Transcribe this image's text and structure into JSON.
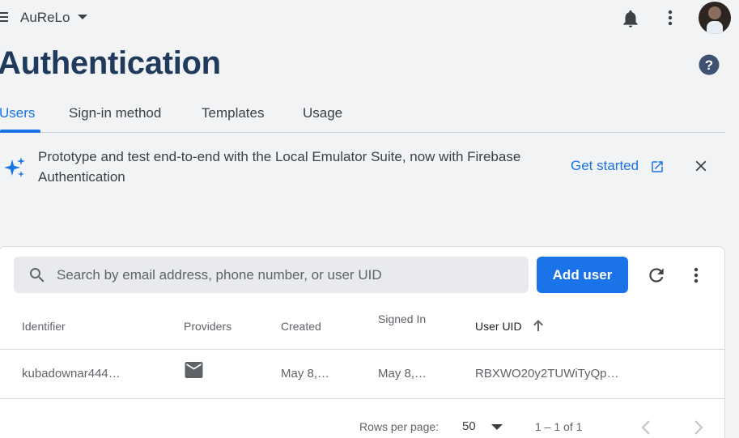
{
  "topbar": {
    "project_name": "AuReLo",
    "icons": [
      "menu-icon",
      "dropdown-caret-icon",
      "notifications-bell-icon",
      "more-vert-icon",
      "avatar"
    ]
  },
  "page": {
    "title": "Authentication",
    "help_icon": "help-icon"
  },
  "tabs": [
    {
      "label": "Users",
      "active": true
    },
    {
      "label": "Sign-in method",
      "active": false
    },
    {
      "label": "Templates",
      "active": false
    },
    {
      "label": "Usage",
      "active": false
    }
  ],
  "banner": {
    "text": "Prototype and test end-to-end with the Local Emulator Suite, now with Firebase Authentication",
    "action_label": "Get started",
    "icon": "sparkle-icon"
  },
  "toolbar": {
    "search_placeholder": "Search by email address, phone number, or user UID",
    "add_user_label": "Add user"
  },
  "table": {
    "columns": [
      "Identifier",
      "Providers",
      "Created",
      "Signed In",
      "User UID"
    ],
    "sorted_column": "User UID",
    "sort_direction": "ascending",
    "rows": [
      {
        "identifier": "kubadownar444…",
        "provider_icon": "email-icon",
        "created": "May 8,…",
        "signed_in": "May 8,…",
        "uid": "RBXWO20y2TUWiTyQp…"
      }
    ]
  },
  "pagination": {
    "rows_per_page_label": "Rows per page:",
    "rows_per_page_value": "50",
    "range_text": "1 – 1 of 1"
  },
  "colors": {
    "accent": "#1a73e8",
    "background": "#f1f3f4",
    "title": "#1f3a5a"
  }
}
